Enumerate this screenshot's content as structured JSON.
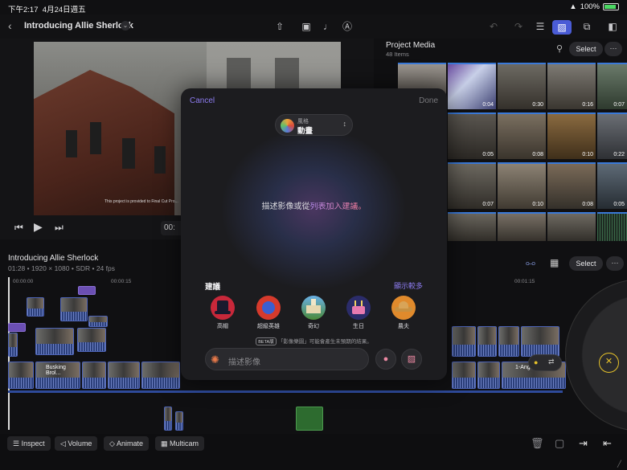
{
  "status": {
    "time": "下午2:17",
    "date": "4月24日週五",
    "battery": "100%"
  },
  "toolbar": {
    "back_icon": "chevron-left-icon",
    "project_title": "Introducing Allie Sherlock"
  },
  "viewer": {
    "timecode": "00:",
    "caption": "This project is provided to Final Cut Pro..."
  },
  "media": {
    "title": "Project Media",
    "count": "48 Items",
    "select_label": "Select",
    "more_label": "···",
    "durations": [
      "",
      "0:04",
      "0:30",
      "0:16",
      "0:07",
      "0:05",
      "0:08",
      "0:10",
      "0:22",
      "0:07",
      "0:10",
      "0:08",
      "0:05"
    ]
  },
  "timeline": {
    "title": "Introducing Allie Sherlock",
    "meta": "01:28 • 1920 × 1080 • SDR • 24 fps",
    "select_label": "Select",
    "more_label": "···",
    "ruler": [
      "00:00:00",
      "00:00:15",
      "00:01:15"
    ],
    "clip_busking": "Busking Brol...",
    "clip_angle": "1-Angl"
  },
  "bottom": {
    "inspect": "Inspect",
    "volume": "Volume",
    "animate": "Animate",
    "multicam": "Multicam"
  },
  "modal": {
    "cancel": "Cancel",
    "done": "Done",
    "style_small": "風格",
    "style_big": "動畫",
    "prompt_a": "描述影像或從",
    "prompt_b": "列表加入建議",
    "prompt_c": "。",
    "suggestions_label": "建議",
    "show_more": "顯示較多",
    "chips": [
      {
        "label": "高帽",
        "icon": "top-hat-icon",
        "color": "#c8283a"
      },
      {
        "label": "超級英雄",
        "icon": "superhero-icon",
        "color": "#d53a2c"
      },
      {
        "label": "奇幻",
        "icon": "castle-icon",
        "color": "#4aa0d8"
      },
      {
        "label": "生日",
        "icon": "cake-icon",
        "color": "#2b2c6a"
      },
      {
        "label": "農夫",
        "icon": "farmer-hat-icon",
        "color": "#e08a2c"
      }
    ],
    "beta_tag": "BETA版",
    "beta_text": "「影像樂園」可能會產生未預期的結果。",
    "input_placeholder": "描述影像"
  },
  "colors": {
    "accent": "#8d7cf0",
    "timeline_blue": "#2b3f7a",
    "jog_yellow": "#e6c22a"
  }
}
